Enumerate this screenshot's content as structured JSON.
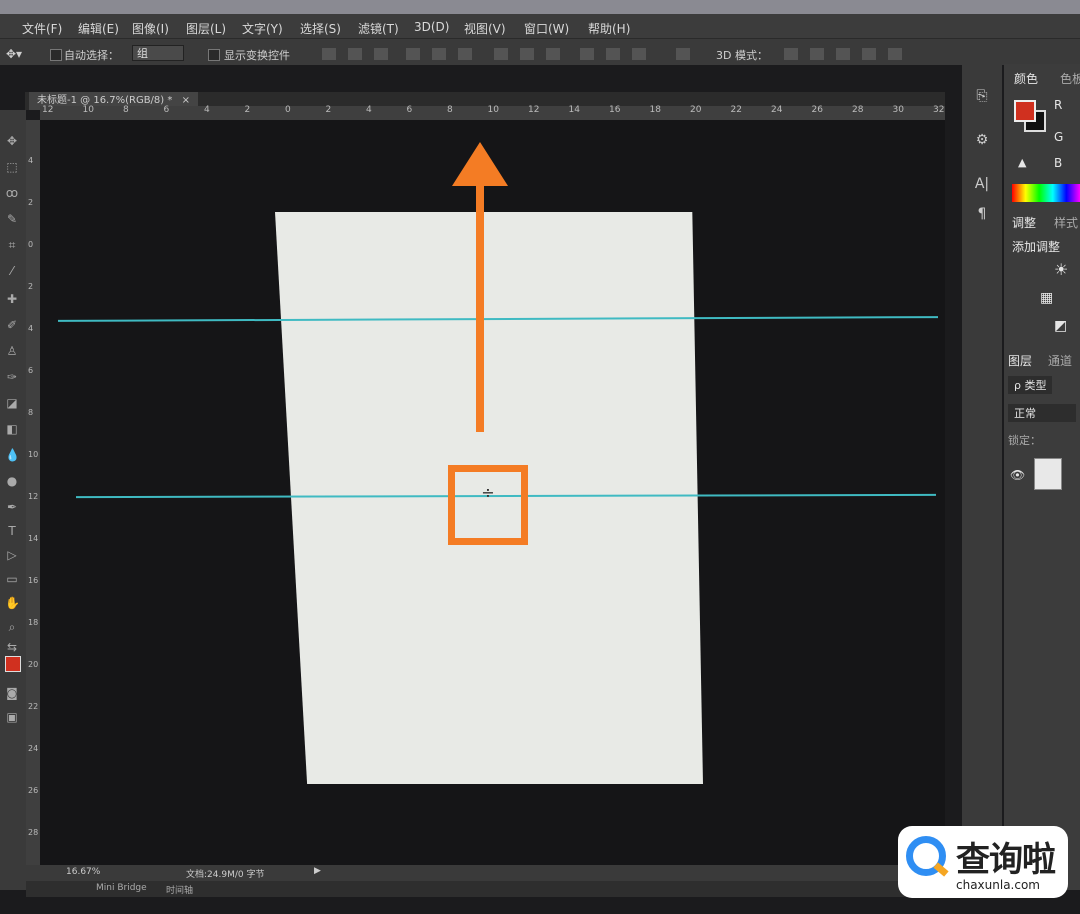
{
  "menubar": {
    "items": [
      "文件(F)",
      "编辑(E)",
      "图像(I)",
      "图层(L)",
      "文字(Y)",
      "选择(S)",
      "滤镜(T)",
      "3D(D)",
      "视图(V)",
      "窗口(W)",
      "帮助(H)"
    ]
  },
  "options": {
    "auto_select_label": "自动选择：",
    "auto_select_value": "组",
    "show_transform_label": "显示变换控件",
    "mode_3d_label": "3D 模式："
  },
  "document": {
    "tab_title": "未标题-1 @ 16.7%(RGB/8) *",
    "close_glyph": "×"
  },
  "ruler": {
    "top_ticks": [
      "12",
      "10",
      "8",
      "6",
      "4",
      "2",
      "0",
      "2",
      "4",
      "6",
      "8",
      "10",
      "12",
      "14",
      "16",
      "18",
      "20",
      "22",
      "24",
      "26",
      "28",
      "30",
      "32"
    ],
    "left_ticks": [
      "4",
      "2",
      "0",
      "2",
      "4",
      "6",
      "8",
      "10",
      "12",
      "14",
      "16",
      "18",
      "20",
      "22",
      "24",
      "26",
      "28"
    ]
  },
  "status": {
    "zoom": "16.67%",
    "doc_info": "文档:24.9M/0 字节"
  },
  "bottom": {
    "mini_bridge": "Mini Bridge",
    "timeline": "时间轴"
  },
  "panels": {
    "color_tab": "颜色",
    "swatches_tab": "色板",
    "r_label": "R",
    "g_label": "G",
    "b_label": "B",
    "adjust_tab": "调整",
    "styles_tab": "样式",
    "add_adjust": "添加调整",
    "layers_tab": "图层",
    "channels_tab": "通道",
    "kind_filter": "ρ 类型",
    "blend_mode": "正常",
    "lock_label": "锁定："
  },
  "logo": {
    "cn": "查询啦",
    "en": "chaxunla.com"
  },
  "colors": {
    "accent_orange": "#f47c24",
    "guide_cyan": "#3fbac2",
    "foreground": "#d0301f"
  }
}
